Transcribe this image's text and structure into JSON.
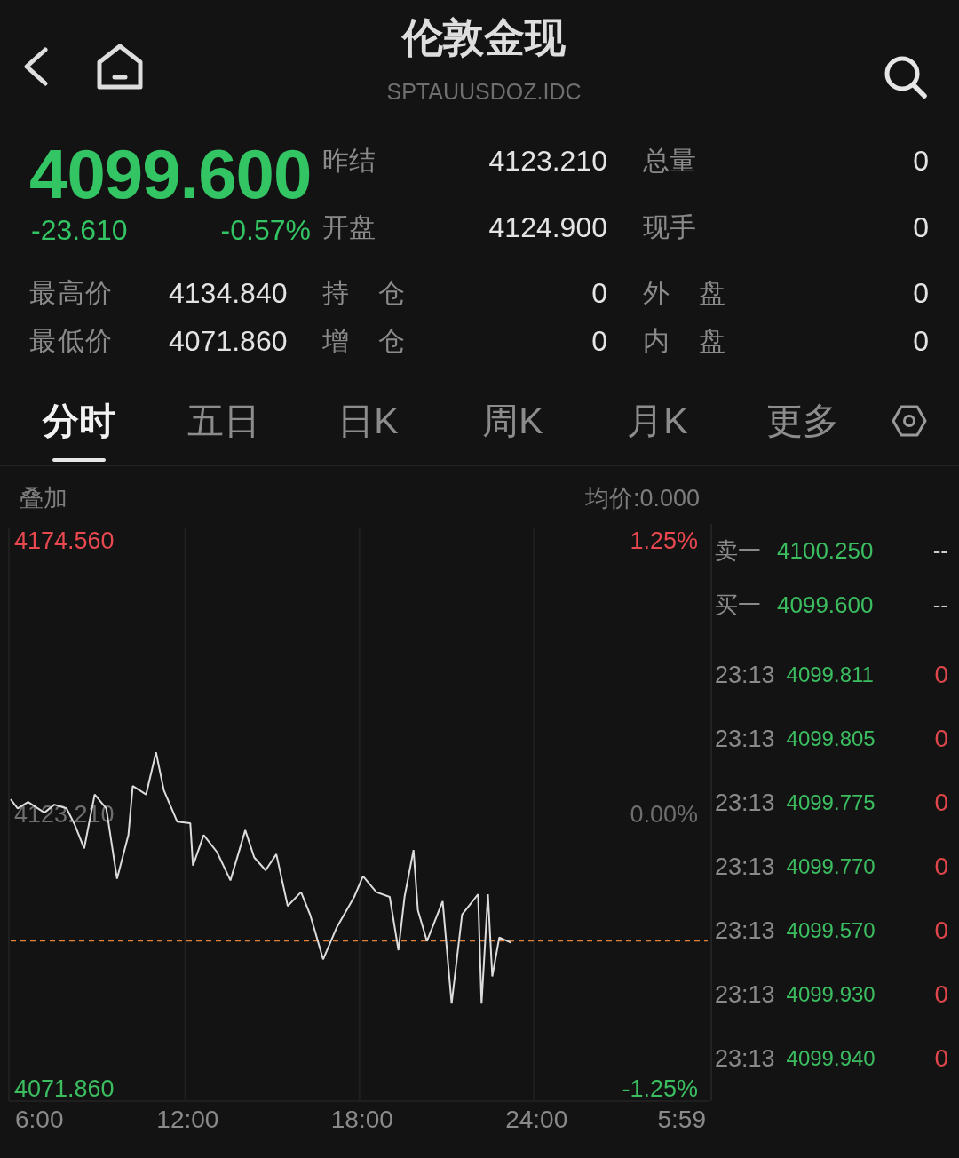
{
  "header": {
    "title": "伦敦金现",
    "symbol": "SPTAUUSDOZ.IDC"
  },
  "quote": {
    "price": "4099.600",
    "change": "-23.610",
    "change_percent": "-0.57%",
    "falling": true,
    "stats": [
      {
        "label": "昨结",
        "value": "4123.210"
      },
      {
        "label": "总量",
        "value": "0"
      },
      {
        "label": "开盘",
        "value": "4124.900"
      },
      {
        "label": "现手",
        "value": "0"
      }
    ],
    "extra_stats": [
      {
        "label": "最高价",
        "value": "4134.840"
      },
      {
        "label": "持 仓",
        "value": "0"
      },
      {
        "label": "外 盘",
        "value": "0"
      },
      {
        "label": "最低价",
        "value": "4071.860"
      },
      {
        "label": "增 仓",
        "value": "0"
      },
      {
        "label": "内 盘",
        "value": "0"
      }
    ]
  },
  "tabs": [
    {
      "label": "分时",
      "selected": true
    },
    {
      "label": "五日",
      "selected": false
    },
    {
      "label": "日K",
      "selected": false
    },
    {
      "label": "周K",
      "selected": false
    },
    {
      "label": "月K",
      "selected": false
    },
    {
      "label": "更多",
      "selected": false
    }
  ],
  "chart": {
    "overlay_label": "叠加",
    "average_price": "均价:0.000",
    "percent_labels": [
      "1.25%",
      "0.00%",
      "-1.25%"
    ],
    "axis_end_label": "5:59",
    "chart_data": {
      "type": "line",
      "x": [
        6.0,
        6.24,
        6.6,
        7.16,
        7.5,
        7.92,
        8.2,
        8.53,
        8.89,
        9.29,
        9.66,
        10.05,
        10.2,
        10.66,
        11.0,
        11.27,
        11.73,
        12.18,
        12.27,
        12.64,
        13.1,
        13.56,
        14.07,
        14.38,
        14.77,
        15.14,
        15.53,
        15.99,
        16.3,
        16.75,
        17.21,
        17.82,
        18.12,
        18.58,
        19.04,
        19.34,
        19.55,
        19.86,
        20.01,
        20.32,
        20.86,
        21.17,
        21.53,
        22.08,
        22.2,
        22.42,
        22.57,
        22.81,
        23.22
      ],
      "series": [
        {
          "color": "#dcdcdc",
          "values": [
            4126.1,
            4124.4,
            4125.6,
            4123.6,
            4125.1,
            4124.4,
            4121.4,
            4116.9,
            4127.0,
            4124.4,
            4111.2,
            4119.4,
            4128.6,
            4127.0,
            4134.9,
            4127.8,
            4121.9,
            4121.6,
            4113.7,
            4119.4,
            4116.2,
            4110.9,
            4120.3,
            4115.2,
            4112.8,
            4115.8,
            4106.1,
            4108.7,
            4104.5,
            4096.1,
            4102.0,
            4107.8,
            4111.7,
            4108.7,
            4107.8,
            4097.8,
            4107.8,
            4116.6,
            4105.3,
            4099.5,
            4107.0,
            4087.8,
            4104.5,
            4108.3,
            4087.8,
            4108.3,
            4092.9,
            4100.2,
            4099.2
          ]
        }
      ],
      "xlim": [
        6,
        29.98
      ],
      "ylim": [
        4069.5,
        4176.9
      ],
      "grid": true,
      "xticks": [
        {
          "value": 6,
          "label": "6:00"
        },
        {
          "value": 12,
          "label": "12:00"
        },
        {
          "value": 18,
          "label": "18:00"
        },
        {
          "value": 24,
          "label": "24:00"
        }
      ],
      "yticks": [
        {
          "value": 4174.56,
          "label": "4174.560"
        },
        {
          "value": 4123.21,
          "label": "4123.210"
        },
        {
          "value": 4071.86,
          "label": "4071.860"
        }
      ],
      "ref_lines": [
        {
          "axis": "y",
          "value": 4099.6
        }
      ]
    }
  },
  "order_book": [
    {
      "label": "卖一",
      "price": "4100.250",
      "volume": "--"
    },
    {
      "label": "买一",
      "price": "4099.600",
      "volume": "--"
    }
  ],
  "trades": [
    {
      "time": "23:13",
      "price": "4099.811",
      "volume": "0"
    },
    {
      "time": "23:13",
      "price": "4099.805",
      "volume": "0"
    },
    {
      "time": "23:13",
      "price": "4099.775",
      "volume": "0"
    },
    {
      "time": "23:13",
      "price": "4099.770",
      "volume": "0"
    },
    {
      "time": "23:13",
      "price": "4099.570",
      "volume": "0"
    },
    {
      "time": "23:13",
      "price": "4099.930",
      "volume": "0"
    },
    {
      "time": "23:13",
      "price": "4099.940",
      "volume": "0"
    }
  ]
}
